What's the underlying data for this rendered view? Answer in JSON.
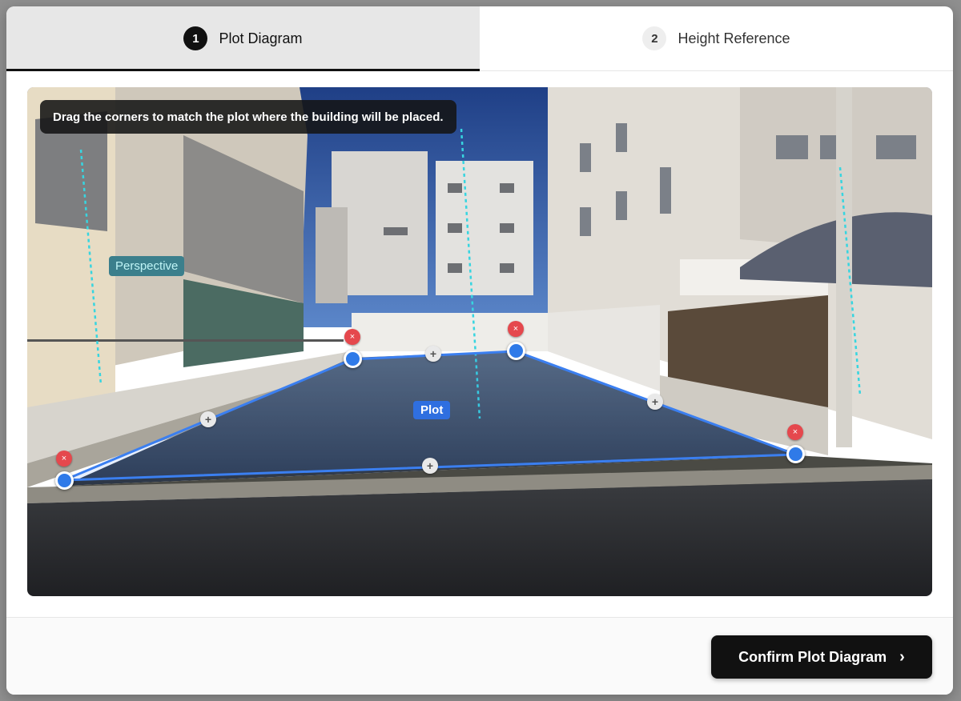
{
  "tabs": [
    {
      "number": "1",
      "label": "Plot Diagram",
      "active": true
    },
    {
      "number": "2",
      "label": "Height Reference",
      "active": false
    }
  ],
  "editor": {
    "instruction": "Drag the corners to match the plot where the building will be placed.",
    "perspective_label": "Perspective",
    "plot_label": "Plot",
    "delete_glyph": "×",
    "add_glyph": "+",
    "colors": {
      "plot_outline": "#3b7ff0",
      "perspective_line": "#37d5e0",
      "handle": "#2f7ae8",
      "delete": "#e5484d"
    }
  },
  "footer": {
    "confirm_label": "Confirm Plot Diagram",
    "confirm_icon": "chevron-right-icon",
    "confirm_glyph": "›"
  }
}
